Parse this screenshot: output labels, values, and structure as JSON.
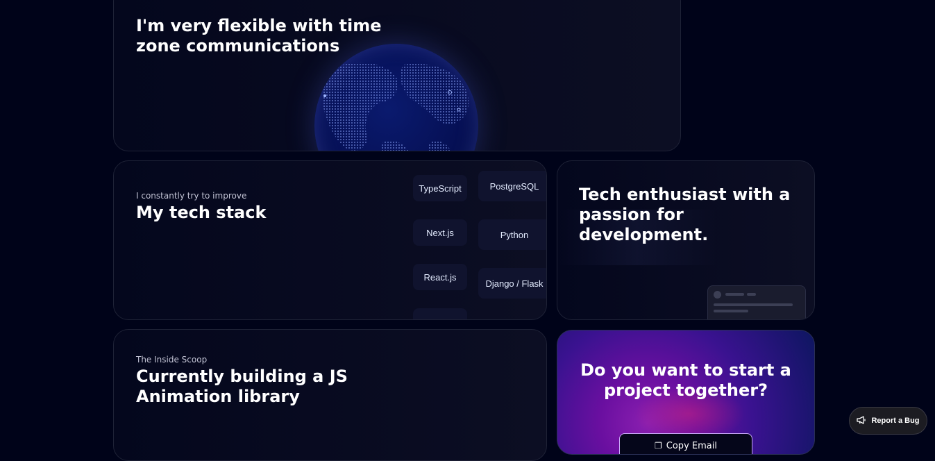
{
  "cards": {
    "timezone": {
      "title_line1": "I'm very flexible with time",
      "title_line2": "zone communications"
    },
    "techstack": {
      "eyebrow": "I constantly try to improve",
      "title": "My tech stack",
      "col1": [
        "TypeScript",
        "Next.js",
        "React.js"
      ],
      "col2": [
        "PostgreSQL",
        "Python",
        "Django / Flask"
      ]
    },
    "enthusiast": {
      "title_line1": "Tech enthusiast with a",
      "title_line2": "passion for development."
    },
    "scoop": {
      "eyebrow": "The Inside Scoop",
      "title_line1": "Currently building a JS",
      "title_line2": "Animation library"
    },
    "cta": {
      "title_line1": "Do you want to start a",
      "title_line2": "project together?",
      "button_label": "Copy Email"
    }
  },
  "report_bug": {
    "label": "Report a Bug",
    "icon": "megaphone-icon"
  },
  "colors": {
    "background": "#000319",
    "card": "#04071d",
    "pill": "#10132e",
    "accent": "#cbacf9"
  }
}
